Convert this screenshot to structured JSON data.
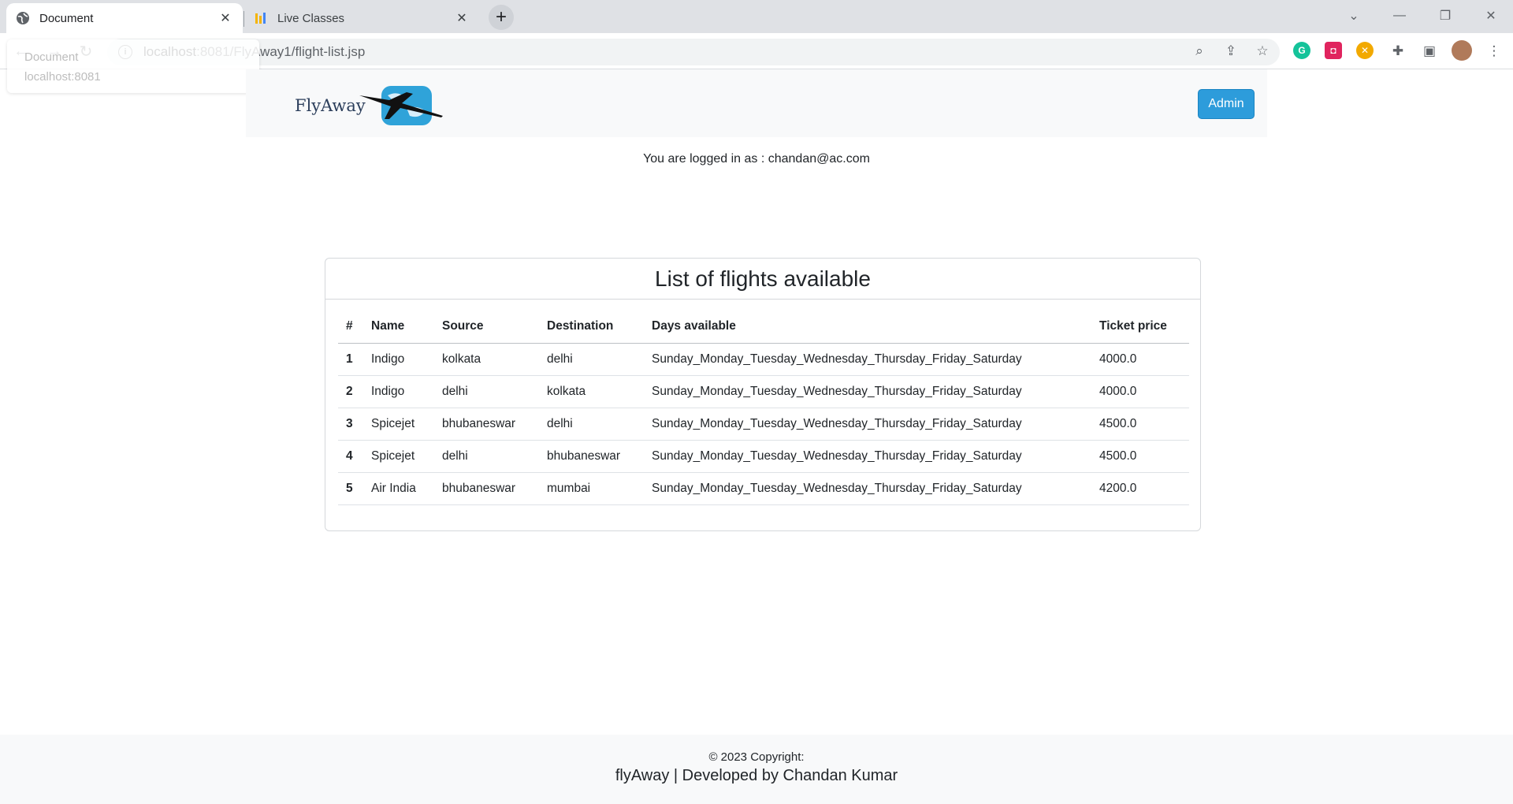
{
  "browser": {
    "tabs": [
      {
        "title": "Document",
        "active": true
      },
      {
        "title": "Live Classes",
        "active": false
      }
    ],
    "address": {
      "host": "localhost",
      "path": ":8081/FlyAway1/flight-list.jsp"
    },
    "tooltip": {
      "title": "Document",
      "host": "localhost:8081"
    }
  },
  "navbar": {
    "brand": "FlyAway",
    "admin_label": "Admin"
  },
  "login": {
    "text": "You are logged in as : chandan@ac.com"
  },
  "card": {
    "title": "List of flights available",
    "columns": [
      "#",
      "Name",
      "Source",
      "Destination",
      "Days available",
      "Ticket price"
    ],
    "rows": [
      {
        "idx": "1",
        "name": "Indigo",
        "source": "kolkata",
        "destination": "delhi",
        "days": "Sunday_Monday_Tuesday_Wednesday_Thursday_Friday_Saturday",
        "price": "4000.0"
      },
      {
        "idx": "2",
        "name": "Indigo",
        "source": "delhi",
        "destination": "kolkata",
        "days": "Sunday_Monday_Tuesday_Wednesday_Thursday_Friday_Saturday",
        "price": "4000.0"
      },
      {
        "idx": "3",
        "name": "Spicejet",
        "source": "bhubaneswar",
        "destination": "delhi",
        "days": "Sunday_Monday_Tuesday_Wednesday_Thursday_Friday_Saturday",
        "price": "4500.0"
      },
      {
        "idx": "4",
        "name": "Spicejet",
        "source": "delhi",
        "destination": "bhubaneswar",
        "days": "Sunday_Monday_Tuesday_Wednesday_Thursday_Friday_Saturday",
        "price": "4500.0"
      },
      {
        "idx": "5",
        "name": "Air India",
        "source": "bhubaneswar",
        "destination": "mumbai",
        "days": "Sunday_Monday_Tuesday_Wednesday_Thursday_Friday_Saturday",
        "price": "4200.0"
      }
    ]
  },
  "footer": {
    "copyright": "© 2023 Copyright:",
    "developer": "flyAway | Developed by Chandan Kumar"
  },
  "colors": {
    "accent": "#2d9cdb",
    "navbar_bg": "#f8f9fa",
    "brand_text": "#2b3e5b"
  }
}
